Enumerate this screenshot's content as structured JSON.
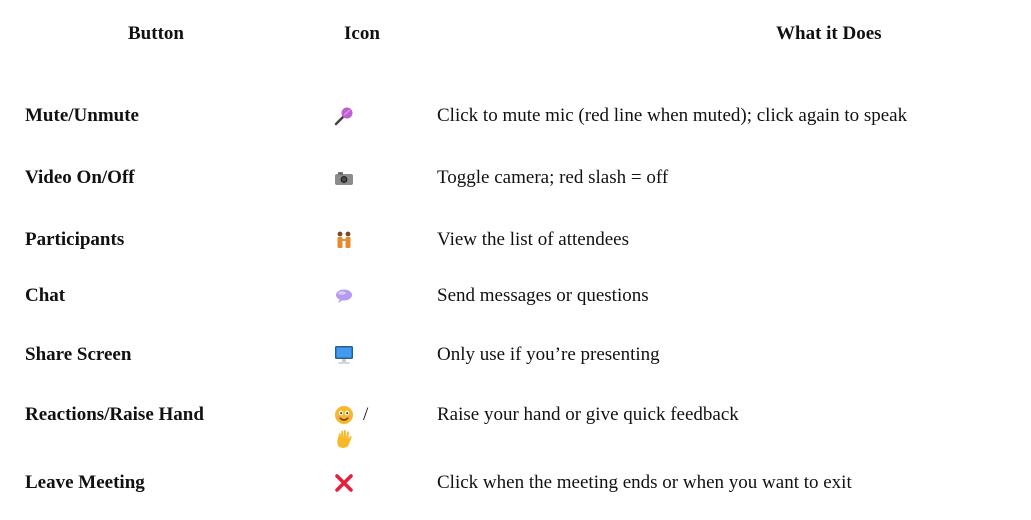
{
  "table": {
    "headers": {
      "button": "Button",
      "icon": "Icon",
      "description": "What it Does"
    },
    "rows": [
      {
        "name": "Mute/Unmute",
        "icon": "microphone-icon",
        "description": "Click to mute mic (red line when muted); click again to speak"
      },
      {
        "name": "Video On/Off",
        "icon": "camera-icon",
        "description": "Toggle camera; red slash = off"
      },
      {
        "name": "Participants",
        "icon": "participants-icon",
        "description": "View the list of attendees"
      },
      {
        "name": "Chat",
        "icon": "chat-bubble-icon",
        "description": "Send messages or questions"
      },
      {
        "name": "Share Screen",
        "icon": "monitor-icon",
        "description": "Only use if you’re presenting"
      },
      {
        "name": "Reactions/Raise Hand",
        "icon": "smiley-icon / raised-hand-icon",
        "icon_separator": "/",
        "description": "Raise your hand or give quick feedback"
      },
      {
        "name": "Leave Meeting",
        "icon": "red-x-icon",
        "description": "Click when the meeting ends or when you want to exit"
      }
    ]
  },
  "colors": {
    "text": "#111111",
    "leave_x": "#e81c3a",
    "chat_bubble": "#b79bf0",
    "monitor_screen": "#3f9cf2",
    "participants": "#e38b2e",
    "smiley": "#f6b928",
    "hand": "#f6b928"
  }
}
